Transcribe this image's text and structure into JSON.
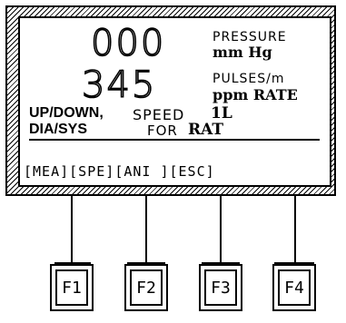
{
  "display": {
    "pressure_value": "000",
    "rate_value": "345",
    "pressure_label": "PRESSURE",
    "pressure_unit": "mm Hg",
    "pulses_label": "PULSES/m",
    "rate_unit": "ppm RATE",
    "line1_left": "UP/DOWN,",
    "line1_mid": "SPEED",
    "line1_right": "1L",
    "line2_left": "DIA/SYS",
    "line2_mid": "FOR",
    "line2_right": "RAT"
  },
  "softkey_labels": [
    "[MEA]",
    "[SPE]",
    "[ANI ]",
    "[ESC]"
  ],
  "keys": [
    "F1",
    "F2",
    "F3",
    "F4"
  ]
}
